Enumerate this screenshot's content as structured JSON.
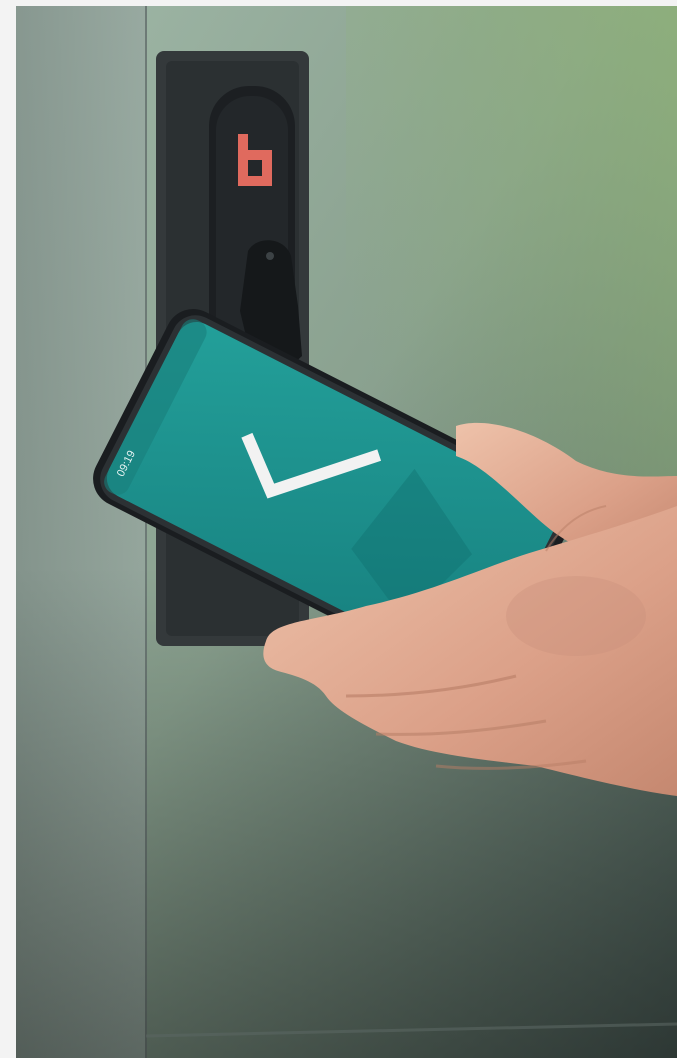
{
  "photo": {
    "lock_brand_mark": "b",
    "phone_status_time": "09:19",
    "colors": {
      "page_background": "#f3f3f3",
      "door_light": "#a8bfa7",
      "door_mid": "#7f9089",
      "door_dark": "#4f5b58",
      "lock_body": "#2b2f31",
      "lock_handle": "#1d2023",
      "logo_red": "#e06a5e",
      "phone_screen": "#1f8f8c",
      "phone_frame": "#1a1d20",
      "checkmark": "#f2f2f2",
      "skin_light": "#e8b8a0",
      "skin_mid": "#d39a80",
      "skin_shadow": "#b77d66"
    },
    "icons": [
      "door-lock",
      "brand-logo",
      "smartphone",
      "checkmark-icon",
      "hand"
    ]
  }
}
